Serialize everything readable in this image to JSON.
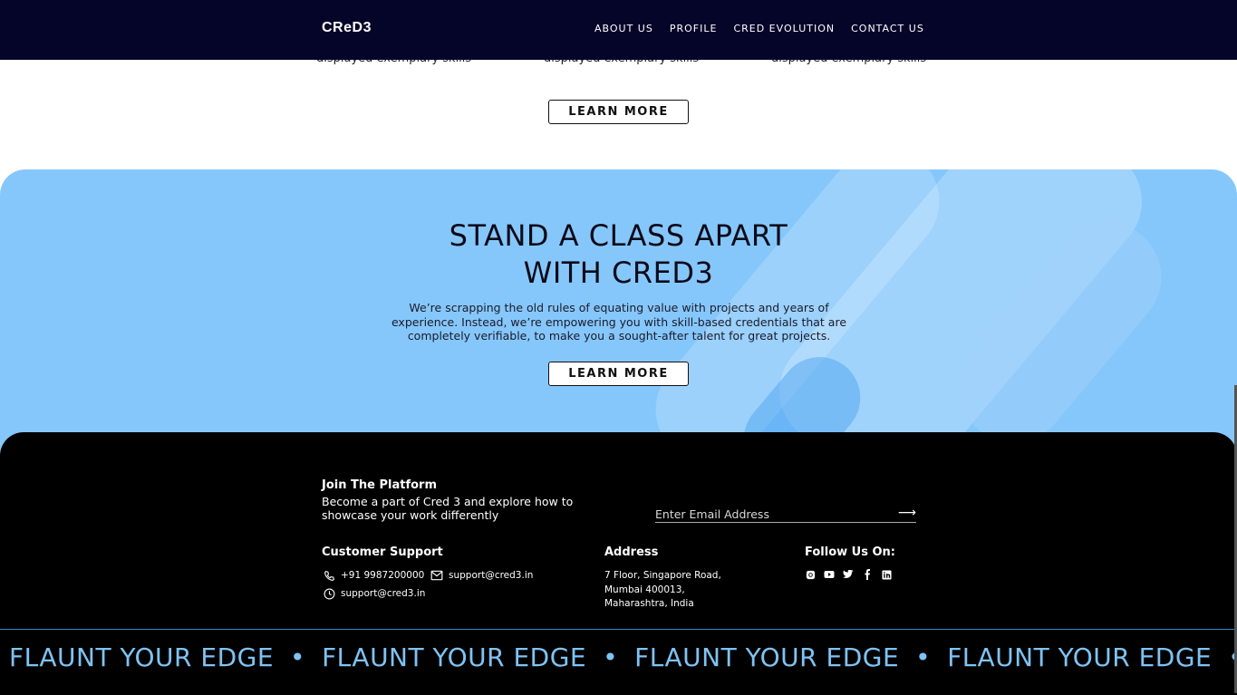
{
  "nav": {
    "logo": "CReD3",
    "links": [
      "ABOUT US",
      "PROFILE",
      "CRED EVOLUTION",
      "CONTACT US"
    ]
  },
  "cards": {
    "partial_texts": [
      "displayed exemplary skills",
      "displayed exemplary skills",
      "displayed exemplary skills"
    ],
    "learn_more_label": "LEARN MORE"
  },
  "hero": {
    "title": "STAND A CLASS APART\nWITH CRED3",
    "description": "We’re scrapping the old rules of equating value with projects and years of experience. Instead, we’re empowering you with skill-based credentials that are completely verifiable, to make you a sought-after talent for great projects.",
    "button_label": "LEARN MORE",
    "background": "#86c7fb"
  },
  "footer": {
    "join_title": "Join The Platform",
    "join_desc": "Become a part of Cred 3 and explore how to showcase your work differently",
    "email_placeholder": "Enter Email Address",
    "support_title": "Customer Support",
    "phone": "+91 9987200000",
    "email": "support@cred3.in",
    "hours_email": "support@cred3.in",
    "address_title": "Address",
    "address": "7 Floor, Singapore Road,\nMumbai 400013,\nMaharashtra, India",
    "follow_title": "Follow Us On:",
    "socials": [
      "instagram-icon",
      "youtube-icon",
      "twitter-icon",
      "facebook-icon",
      "linkedin-icon"
    ]
  },
  "marquee": {
    "text": "FLAUNT YOUR EDGE",
    "separator": "•",
    "color": "#7fc3f4"
  }
}
